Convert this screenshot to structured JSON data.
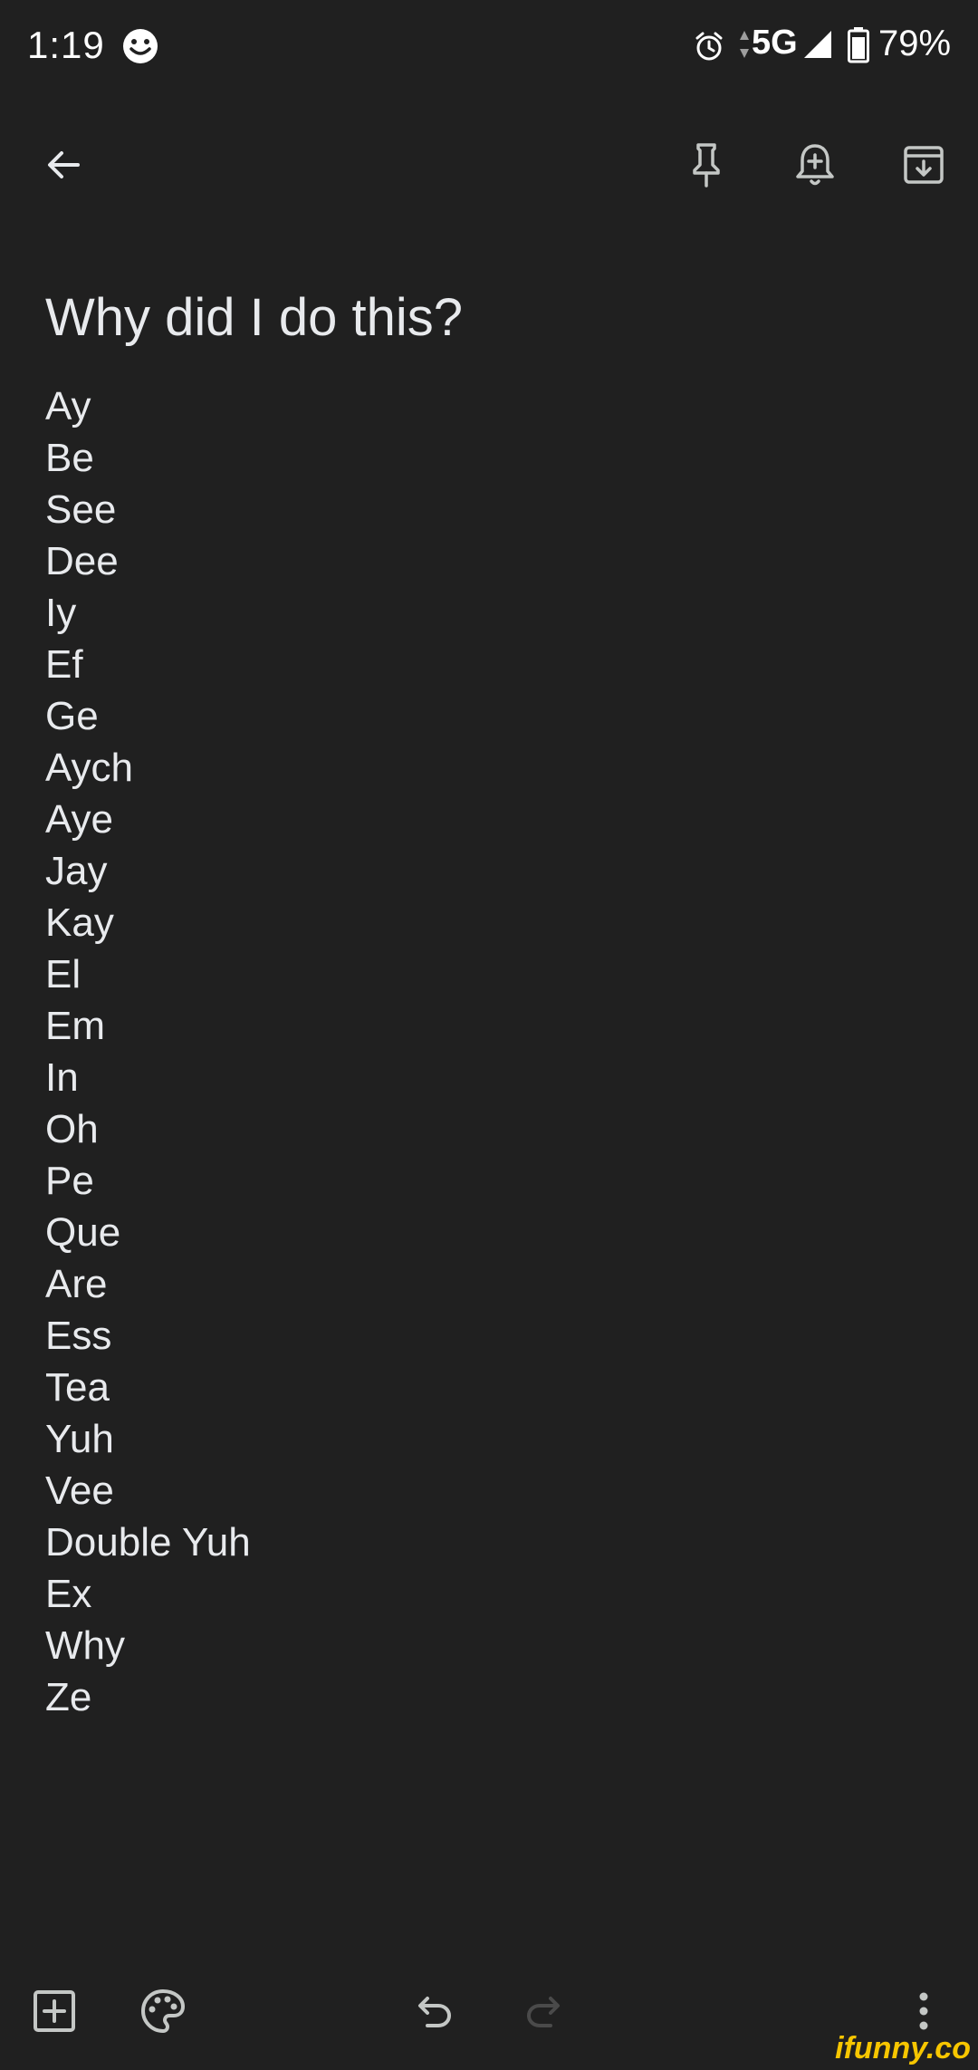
{
  "status_bar": {
    "time": "1:19",
    "network": "5G",
    "battery": "79%"
  },
  "toolbar": {
    "back_icon": "arrow-back-icon",
    "pin_icon": "pin-icon",
    "reminder_icon": "add-reminder-icon",
    "archive_icon": "archive-icon"
  },
  "note": {
    "title": "Why did I do this?",
    "lines": [
      "Ay",
      "Be",
      "See",
      "Dee",
      "Iy",
      "Ef",
      "Ge",
      "Aych",
      "Aye",
      "Jay",
      "Kay",
      "El",
      "Em",
      "In",
      "Oh",
      "Pe",
      "Que",
      "Are",
      "Ess",
      "Tea",
      "Yuh",
      "Vee",
      "Double Yuh",
      "Ex",
      "Why",
      "Ze"
    ]
  },
  "bottom_bar": {
    "add_icon": "add-box-icon",
    "palette_icon": "palette-icon",
    "undo_icon": "undo-icon",
    "redo_icon": "redo-icon",
    "more_icon": "more-vert-icon"
  },
  "watermark": "ifunny.co",
  "colors": {
    "background": "#202020",
    "text": "#e8eaed",
    "icon": "#c4c7c5",
    "disabled_icon": "#4a4a4a",
    "watermark": "#f7c600"
  }
}
